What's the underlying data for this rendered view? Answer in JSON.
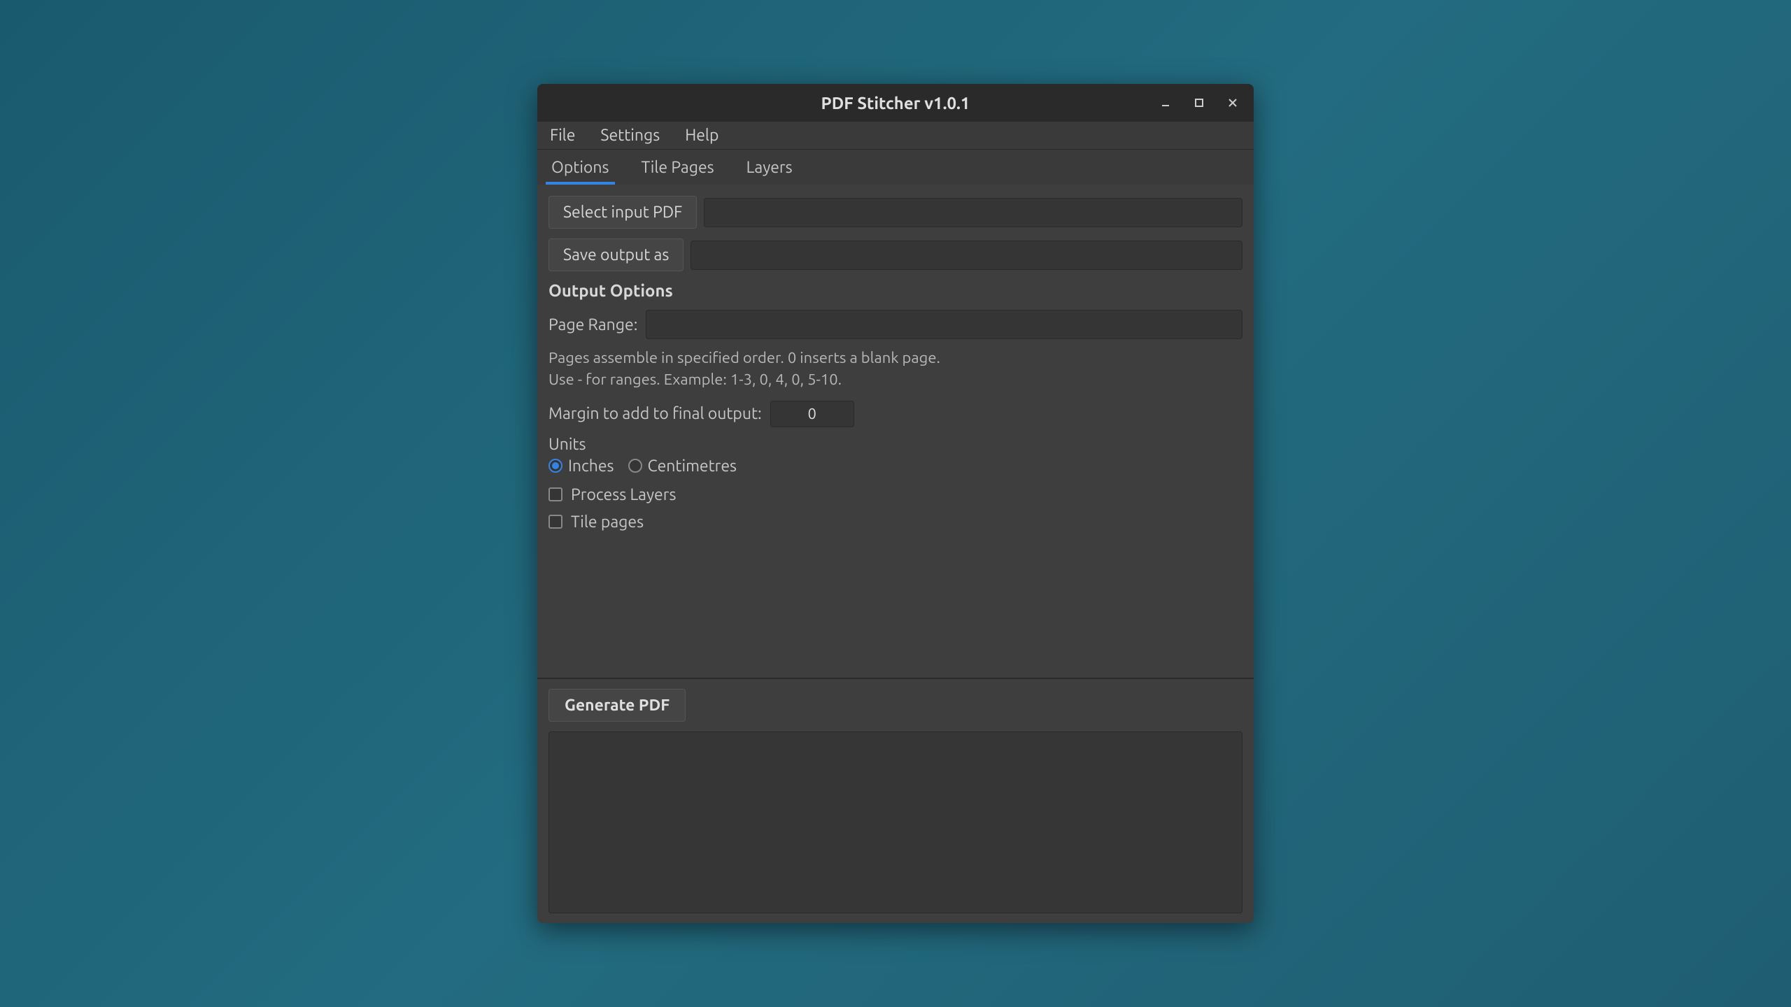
{
  "window": {
    "title": "PDF Stitcher v1.0.1"
  },
  "menubar": {
    "file": "File",
    "settings": "Settings",
    "help": "Help"
  },
  "tabs": {
    "options": "Options",
    "tile_pages": "Tile Pages",
    "layers": "Layers"
  },
  "buttons": {
    "select_input": "Select input PDF",
    "save_output": "Save output as",
    "generate": "Generate PDF"
  },
  "inputs": {
    "input_path": "",
    "output_path": "",
    "page_range": "",
    "margin": "0"
  },
  "labels": {
    "output_options": "Output Options",
    "page_range": "Page Range:",
    "helper_line1": "Pages assemble in specified order. 0 inserts a blank page.",
    "helper_line2": "Use - for ranges. Example: 1-3, 0, 4, 0, 5-10.",
    "margin": "Margin to add to final output:",
    "units": "Units",
    "inches": "Inches",
    "centimetres": "Centimetres",
    "process_layers": "Process Layers",
    "tile_pages": "Tile pages"
  },
  "state": {
    "active_tab": "options",
    "units": "inches",
    "process_layers": false,
    "tile_pages": false
  }
}
